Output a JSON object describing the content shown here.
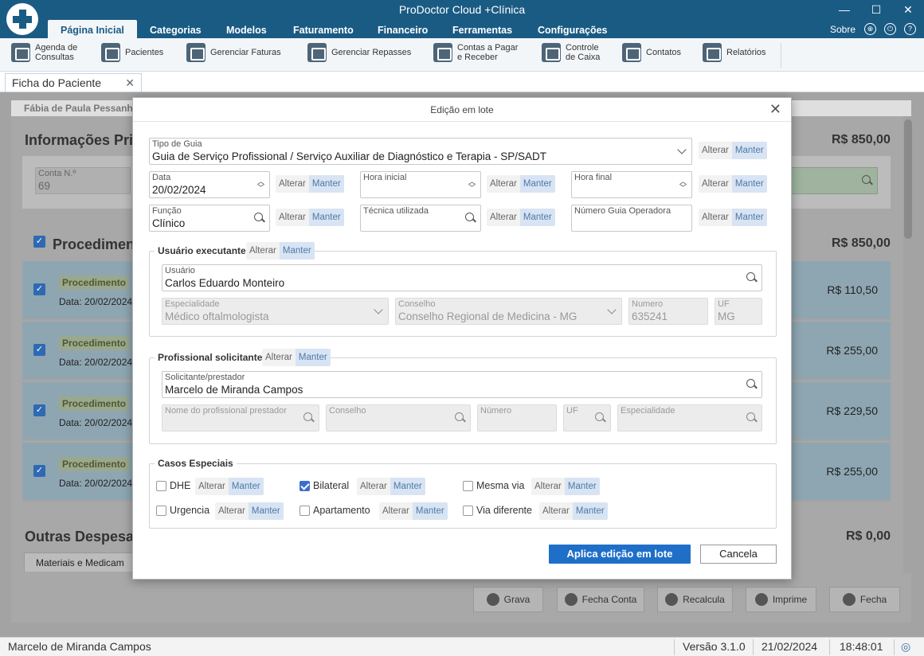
{
  "app": {
    "title": "ProDoctor Cloud +Clínica",
    "menu": [
      "Página Inicial",
      "Categorias",
      "Modelos",
      "Faturamento",
      "Financeiro",
      "Ferramentas",
      "Configurações"
    ],
    "sobre": "Sobre"
  },
  "toolbar": [
    {
      "label": "Agenda de\nConsultas",
      "icon": "calendar-icon"
    },
    {
      "label": "Pacientes",
      "icon": "patient-card-icon"
    },
    {
      "label": "Gerenciar Faturas",
      "icon": "invoice-icon"
    },
    {
      "label": "Gerenciar Repasses",
      "icon": "transfer-icon"
    },
    {
      "label": "Contas a Pagar\ne Receber",
      "icon": "money-icon"
    },
    {
      "label": "Controle\nde Caixa",
      "icon": "cash-register-icon"
    },
    {
      "label": "Contatos",
      "icon": "phone-book-icon"
    },
    {
      "label": "Relatórios",
      "icon": "report-icon"
    }
  ],
  "doc_tab": "Ficha do Paciente",
  "background": {
    "patient": "Fábia de Paula Pessanh",
    "info_title": "Informações Princ",
    "info_total": "R$ 850,00",
    "conta_label": "Conta N.º",
    "conta_value": "69",
    "proc_title": "Procedimento",
    "proc_total": "R$ 850,00",
    "procedures": [
      {
        "badge": "Procedimento",
        "date": "Data: 20/02/2024",
        "value": "R$ 110,50"
      },
      {
        "badge": "Procedimento",
        "date": "Data: 20/02/2024",
        "value": "R$ 255,00"
      },
      {
        "badge": "Procedimento",
        "date": "Data: 20/02/2024",
        "value": "R$ 229,50"
      },
      {
        "badge": "Procedimento",
        "date": "Data: 20/02/2024",
        "value": "R$ 255,00"
      }
    ],
    "outras_title": "Outras Despesas",
    "outras_total": "R$ 0,00",
    "materiais_tab": "Materiais e Medicam",
    "buttons": [
      "Grava",
      "Fecha Conta",
      "Recalcula",
      "Imprime",
      "Fecha"
    ]
  },
  "status": {
    "user": "Marcelo de Miranda Campos",
    "version": "Versão 3.1.0",
    "date": "21/02/2024",
    "time": "18:48:01"
  },
  "dialog": {
    "title": "Edição em lote",
    "alterar": "Alterar",
    "manter": "Manter",
    "tipo_guia": {
      "label": "Tipo de Guia",
      "value": "Guia de Serviço Profissional / Serviço Auxiliar de Diagnóstico e Terapia - SP/SADT"
    },
    "data": {
      "label": "Data",
      "value": "20/02/2024"
    },
    "hora_inicial": {
      "label": "Hora inicial",
      "value": ""
    },
    "hora_final": {
      "label": "Hora final",
      "value": ""
    },
    "funcao": {
      "label": "Função",
      "value": "Clínico"
    },
    "tecnica": {
      "label": "Técnica utilizada",
      "value": ""
    },
    "numero_guia": {
      "label": "Número Guia Operadora",
      "value": ""
    },
    "executante": {
      "title": "Usuário executante",
      "usuario": {
        "label": "Usuário",
        "value": "Carlos Eduardo Monteiro"
      },
      "especialidade": {
        "label": "Especialidade",
        "value": "Médico oftalmologista"
      },
      "conselho": {
        "label": "Conselho",
        "value": "Conselho Regional de Medicina - MG"
      },
      "numero": {
        "label": "Numero",
        "value": "635241"
      },
      "uf": {
        "label": "UF",
        "value": "MG"
      }
    },
    "solicitante": {
      "title": "Profissional solicitante",
      "solicitante": {
        "label": "Solicitante/prestador",
        "value": "Marcelo de Miranda Campos"
      },
      "nome_prof": {
        "label": "Nome do profissional prestador"
      },
      "conselho": {
        "label": "Conselho"
      },
      "numero": {
        "label": "Número"
      },
      "uf": {
        "label": "UF"
      },
      "especialidade": {
        "label": "Especialidade"
      }
    },
    "casos": {
      "title": "Casos Especiais",
      "items": [
        {
          "label": "DHE",
          "checked": false
        },
        {
          "label": "Bilateral",
          "checked": true
        },
        {
          "label": "Mesma via",
          "checked": false
        },
        {
          "label": "Urgencia",
          "checked": false
        },
        {
          "label": "Apartamento",
          "checked": false
        },
        {
          "label": "Via diferente",
          "checked": false
        }
      ]
    },
    "apply": "Aplica edição em lote",
    "cancel": "Cancela"
  }
}
